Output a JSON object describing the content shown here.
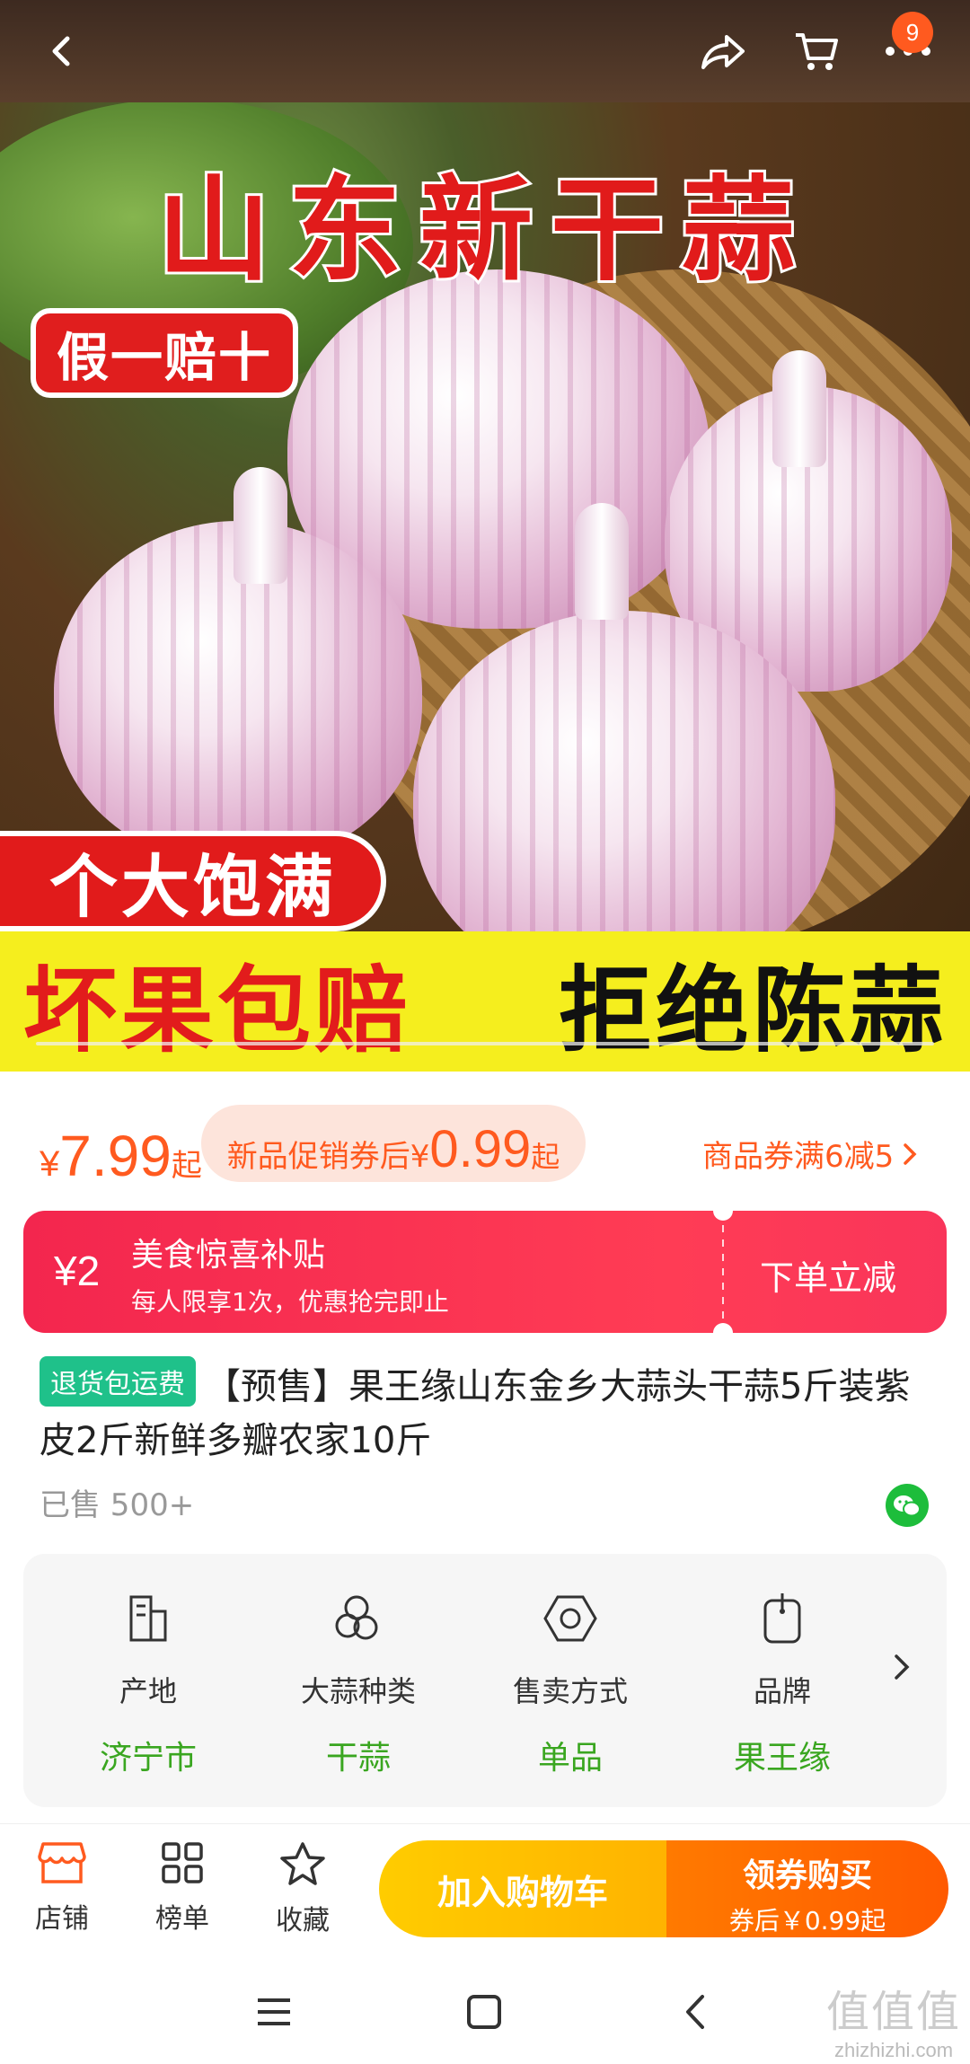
{
  "topbar": {
    "cart_count": "9"
  },
  "hero": {
    "title": "山东新干蒜",
    "badge": "假一赔十",
    "full_badge": "个大饱满",
    "band_left": "坏果包赔",
    "band_right": "拒绝陈蒜"
  },
  "price": {
    "currency": "¥",
    "value": "7.99",
    "suffix": "起",
    "promo_label": "新品促销券后¥",
    "promo_value": "0.99",
    "promo_suffix": "起",
    "coupon_link": "商品券满6减5"
  },
  "subsidy": {
    "amount": "¥2",
    "title": "美食惊喜补贴",
    "desc": "每人限享1次，优惠抢完即止",
    "cta": "下单立减"
  },
  "product": {
    "return_tag": "退货包运费",
    "title": "【预售】果王缘山东金乡大蒜头干蒜5斤装紫皮2斤新鲜多瓣农家10斤",
    "sold": "已售 500+"
  },
  "attributes": [
    {
      "name": "产地",
      "value": "济宁市",
      "icon": "building-icon"
    },
    {
      "name": "大蒜种类",
      "value": "干蒜",
      "icon": "circles-icon"
    },
    {
      "name": "售卖方式",
      "value": "单品",
      "icon": "hex-nut-icon"
    },
    {
      "name": "品牌",
      "value": "果王缘",
      "icon": "tag-icon"
    }
  ],
  "bottom_nav": {
    "store": "店铺",
    "ranking": "榜单",
    "favorite": "收藏",
    "add_to_cart": "加入购物车",
    "buy_line1": "领券购买",
    "buy_line2": "券后￥0.99起"
  },
  "watermark": {
    "big": "值值值",
    "small": "zhizhizhi.com"
  },
  "colors": {
    "accent": "#ff5a1f",
    "green": "#3aa620",
    "subsidy": "#f3264e",
    "cart_btn": "#ffc400",
    "buy_btn": "#ff6a00"
  }
}
